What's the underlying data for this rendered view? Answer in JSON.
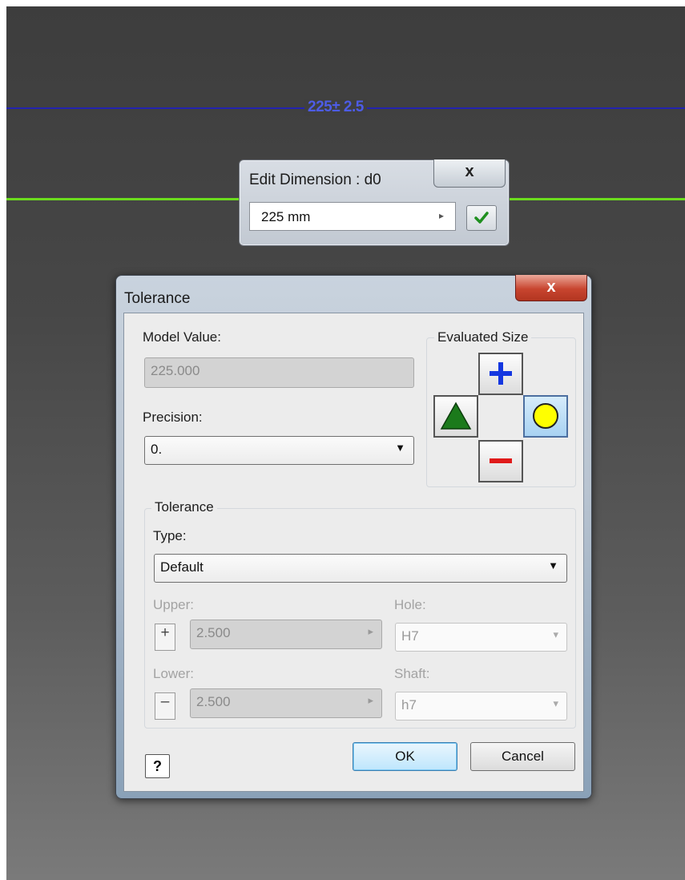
{
  "canvas": {
    "dimension_label": "225± 2.5"
  },
  "edit_dimension": {
    "title": "Edit Dimension : d0",
    "close_label": "x",
    "value": "225 mm",
    "arrow": "▸",
    "accept_icon": "check-icon"
  },
  "tolerance_dialog": {
    "title": "Tolerance",
    "close_label": "x",
    "model_value_label": "Model Value:",
    "model_value": "225.000",
    "precision_label": "Precision:",
    "precision_value": "0.",
    "evaluated_size": {
      "title": "Evaluated Size",
      "upper_icon": "plus-icon",
      "nominal_icon": "triangle-icon",
      "median_icon": "circle-icon",
      "lower_icon": "minus-icon",
      "active": "median"
    },
    "tolerance_group": {
      "legend": "Tolerance",
      "type_label": "Type:",
      "type_value": "Default",
      "upper_label": "Upper:",
      "upper_value": "2.500",
      "upper_sign": "+",
      "lower_label": "Lower:",
      "lower_value": "2.500",
      "lower_sign": "–",
      "hole_label": "Hole:",
      "hole_value": "H7",
      "shaft_label": "Shaft:",
      "shaft_value": "h7"
    },
    "help_label": "?",
    "ok_label": "OK",
    "cancel_label": "Cancel"
  },
  "colors": {
    "dimension_line": "#2323b0",
    "sketch_line": "#6cdc1e",
    "close_button": "#c8452f",
    "plus_icon": "#1437e0",
    "minus_icon": "#e01a1a",
    "triangle_icon": "#1b7a1b",
    "circle_icon": "#ffff00"
  }
}
